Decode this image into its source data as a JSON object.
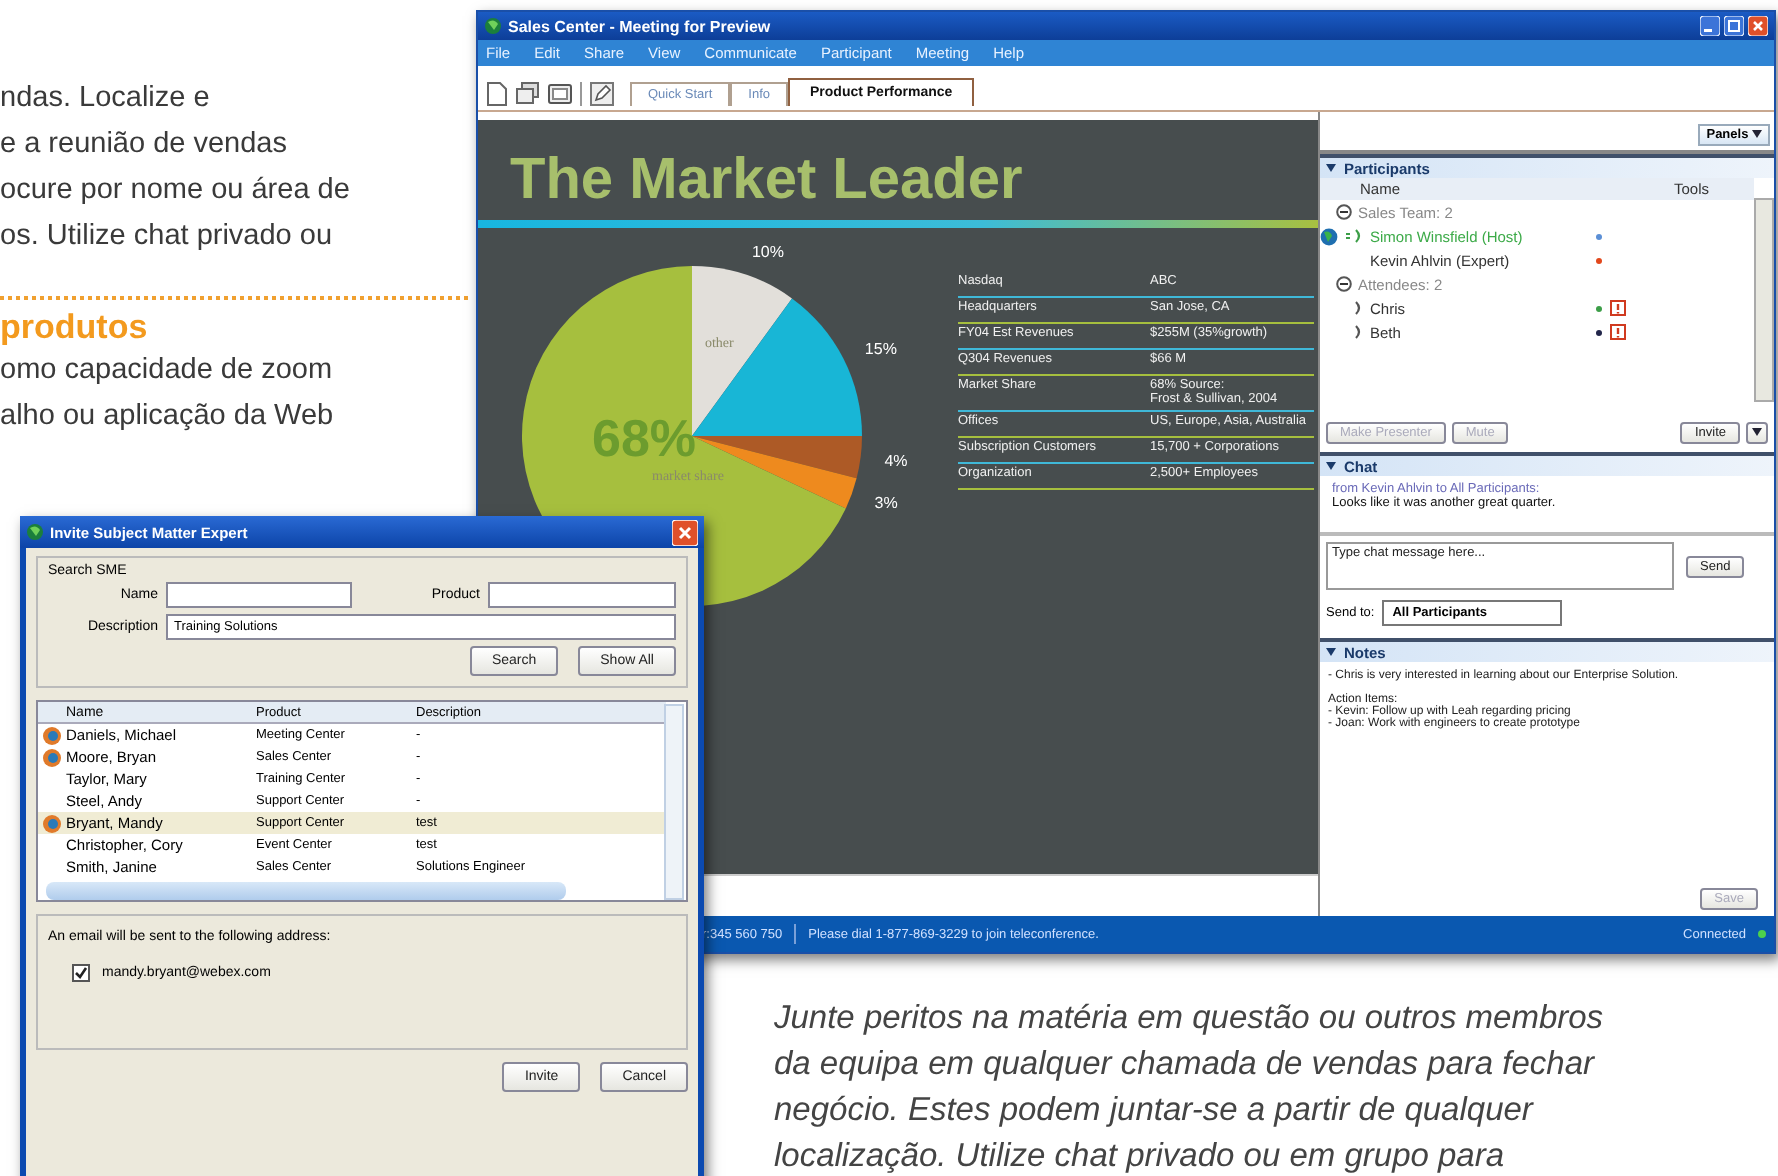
{
  "brochure": {
    "top_lines": [
      "ndas. Localize e",
      "e a reunião de vendas",
      "ocure por nome ou área de",
      "os. Utilize chat privado ou"
    ],
    "heading": "produtos",
    "lines": [
      "omo capacidade de zoom",
      "alho ou aplicação da Web"
    ],
    "caption_lines": [
      "Junte peritos na matéria em questão ou outros membros",
      "da equipa em qualquer chamada de vendas para fechar",
      "negócio. Estes podem juntar-se a partir de qualquer",
      "localização. Utilize chat privado ou em grupo para"
    ]
  },
  "main_window": {
    "title": "Sales Center - Meeting for Preview",
    "menu": [
      "File",
      "Edit",
      "Share",
      "View",
      "Communicate",
      "Participant",
      "Meeting",
      "Help"
    ],
    "tabs": [
      {
        "label": "Quick Start",
        "selected": false
      },
      {
        "label": "Info",
        "selected": false
      },
      {
        "label": "Product Performance",
        "selected": true
      }
    ],
    "slide": {
      "title": "The Market Leader",
      "chart_data": {
        "type": "pie",
        "values": [
          10,
          15,
          4,
          3,
          68
        ],
        "colors": [
          "#e2dfda",
          "#18b6d6",
          "#ad5a26",
          "#ee8a1e",
          "#a6bf3e"
        ],
        "value_labels": [
          "10%",
          "15%",
          "4%",
          "3%",
          "68%"
        ]
      },
      "slice_labels": [
        "other",
        "market share"
      ],
      "facts": [
        {
          "label": "Nasdaq",
          "value": "ABC"
        },
        {
          "label": "Headquarters",
          "value": "San Jose, CA"
        },
        {
          "label": "FY04 Est Revenues",
          "value": "$255M (35%growth)"
        },
        {
          "label": "Q304 Revenues",
          "value": "$66 M"
        },
        {
          "label": "Market Share",
          "value": "68% Source:",
          "value_2": "Frost & Sullivan, 2004"
        },
        {
          "label": "Offices",
          "value": "US, Europe, Asia, Australia"
        },
        {
          "label": "Subscription Customers",
          "value": "15,700 + Corporations"
        },
        {
          "label": "Organization",
          "value": "2,500+ Employees"
        }
      ]
    },
    "panels_button": "Panels",
    "participants": {
      "title": "Participants",
      "columns": [
        "Name",
        "Tools"
      ],
      "groups": [
        {
          "label": "Sales Team: 2",
          "expanded": true,
          "children": [
            {
              "name": "Simon Winsfield (Host)",
              "host": true,
              "presenter": true,
              "audio": true,
              "speaking": true,
              "color": "#5b8fd6",
              "alert": false
            },
            {
              "name": "Kevin Ahlvin (Expert)",
              "host": false,
              "presenter": false,
              "audio": false,
              "color": "#e2481c",
              "alert": false
            }
          ]
        },
        {
          "label": "Attendees: 2",
          "expanded": true,
          "children": [
            {
              "name": "Chris",
              "host": false,
              "presenter": false,
              "audio": true,
              "speaking": false,
              "color": "#3c9e48",
              "alert": true
            },
            {
              "name": "Beth",
              "host": false,
              "presenter": false,
              "audio": true,
              "speaking": false,
              "color": "#22264a",
              "alert": true
            }
          ]
        }
      ],
      "buttons": [
        {
          "label": "Make Presenter",
          "disabled": true
        },
        {
          "label": "Mute",
          "disabled": true
        },
        {
          "label": "Invite",
          "disabled": false
        }
      ]
    },
    "chat": {
      "title": "Chat",
      "sender_line": "from Kevin Ahlvin to All Participants:",
      "message": "Looks like it was another great quarter.",
      "input_placeholder": "Type chat message here...",
      "send_button": "Send",
      "send_to_label": "Send to:",
      "send_to_value": "All Participants"
    },
    "notes": {
      "title": "Notes",
      "lines": [
        "- Chris is very interested in learning about our Enterprise Solution.",
        "Action Items:",
        "- Kevin: Follow up with Leah regarding pricing",
        "- Joan: Work with engineers to create prototype"
      ],
      "save_button": {
        "label": "Save",
        "disabled": true
      }
    },
    "status_bar": {
      "number": "r:345 560 750",
      "message": "Please dial 1-877-869-3229 to join teleconference.",
      "connection": "Connected"
    }
  },
  "dialog": {
    "title": "Invite Subject Matter Expert",
    "group_label": "Search SME",
    "fields": [
      {
        "label": "Name"
      },
      {
        "label": "Product"
      },
      {
        "label": "Description",
        "value": "Training Solutions"
      }
    ],
    "search_buttons": [
      "Search",
      "Show All"
    ],
    "columns": [
      "Name",
      "Product",
      "Description"
    ],
    "rows": [
      {
        "name": "Daniels, Michael",
        "product": "Meeting Center",
        "description": "-",
        "online": true,
        "selected": false
      },
      {
        "name": "Moore, Bryan",
        "product": "Sales Center",
        "description": "-",
        "online": true,
        "selected": false
      },
      {
        "name": "Taylor, Mary",
        "product": "Training Center",
        "description": "-",
        "online": false,
        "selected": false
      },
      {
        "name": "Steel, Andy",
        "product": "Support Center",
        "description": "-",
        "online": false,
        "selected": false
      },
      {
        "name": "Bryant, Mandy",
        "product": "Support Center",
        "description": "test",
        "online": true,
        "selected": true
      },
      {
        "name": "Christopher, Cory",
        "product": "Event Center",
        "description": "test",
        "online": false,
        "selected": false
      },
      {
        "name": "Smith, Janine",
        "product": "Sales Center",
        "description": "Solutions Engineer",
        "online": false,
        "selected": false
      }
    ],
    "email_note": "An email will be sent to the following address:",
    "email": {
      "address": "mandy.bryant@webex.com",
      "checked": true
    },
    "buttons": [
      "Invite",
      "Cancel"
    ]
  }
}
